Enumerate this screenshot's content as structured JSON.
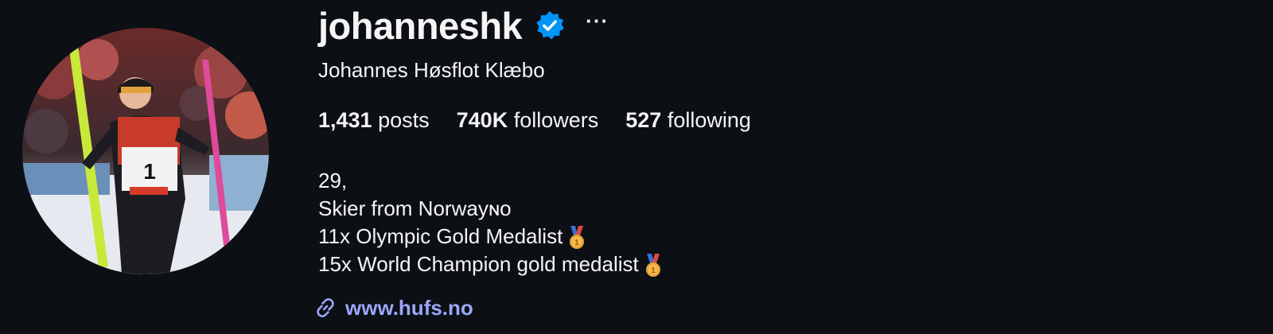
{
  "profile": {
    "username": "johanneshk",
    "verified": true,
    "more_options": "···",
    "full_name": "Johannes Høsflot Klæbo",
    "avatar_icon": "profile-photo-skier",
    "bib_number": "1"
  },
  "stats": {
    "posts_count": "1,431",
    "posts_label": "posts",
    "followers_count": "740K",
    "followers_label": "followers",
    "following_count": "527",
    "following_label": "following"
  },
  "bio": {
    "line1": "29,",
    "line2": "Skier from Norwayɴᴏ",
    "line3": "11x Olympic Gold Medalist",
    "line4": "15x World Champion gold medalist",
    "medal_icon": "gold-medal-icon"
  },
  "link": {
    "text": "www.hufs.no",
    "icon": "link-icon"
  },
  "colors": {
    "background": "#0c0f14",
    "text": "#f5f5f5",
    "verified_blue": "#0095f6",
    "link": "#9aa8f9"
  }
}
